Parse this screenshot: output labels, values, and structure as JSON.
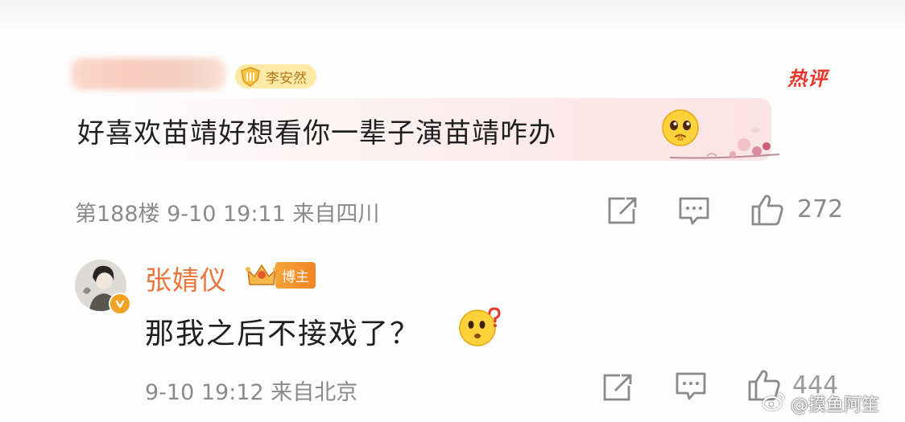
{
  "comment": {
    "fan_badge": "李安然",
    "hot_label": "热评",
    "text": "好喜欢苗靖好想看你一辈子演苗靖咋办",
    "emoji_icon": "pleading-face-icon",
    "meta": "第188楼  9-10 19:11  来自四川",
    "actions": {
      "share_icon": "share-icon",
      "comment_icon": "comment-icon",
      "like_icon": "thumbs-up-icon",
      "like_count": "272"
    }
  },
  "reply": {
    "author": "张婧仪",
    "badge": "博主",
    "text": "那我之后不接戏了？",
    "emoji_icon": "confused-face-icon",
    "meta": "9-10 19:12  来自北京",
    "actions": {
      "share_icon": "share-icon",
      "comment_icon": "comment-icon",
      "like_icon": "thumbs-up-icon",
      "like_count": "444"
    }
  },
  "watermark": "@摸鱼阿笙",
  "colors": {
    "hot": "#e8362b",
    "author": "#e9753a",
    "meta": "#8a8a8a",
    "badge_bg": "#ffe9a6"
  }
}
